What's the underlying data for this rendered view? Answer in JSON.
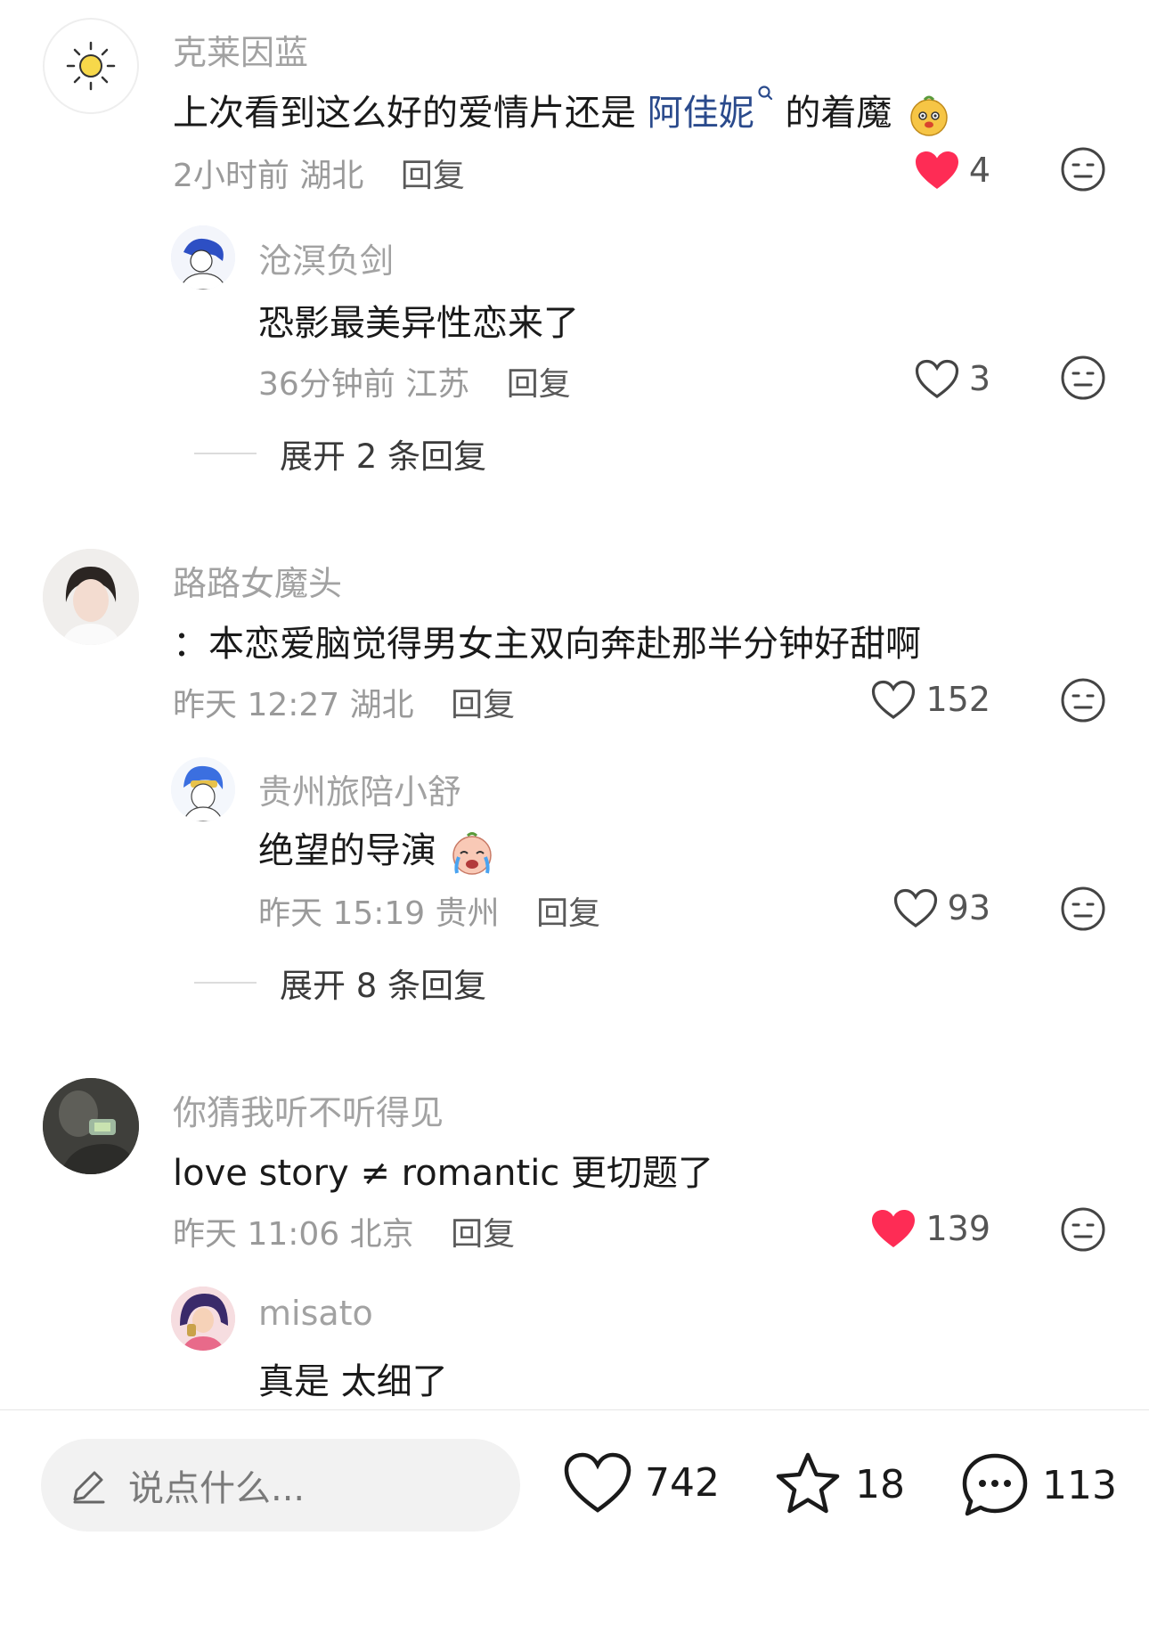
{
  "comments": [
    {
      "username": "克莱因蓝",
      "text_pre": "上次看到这么好的爱情片还是 ",
      "mention": "阿佳妮",
      "text_post": " 的着魔",
      "time": "2小时前",
      "location": "湖北",
      "reply_label": "回复",
      "likes": "4",
      "liked": true,
      "replies": [
        {
          "username": "沧溟负剑",
          "text": "恐影最美异性恋来了",
          "time": "36分钟前",
          "location": "江苏",
          "reply_label": "回复",
          "likes": "3",
          "liked": false
        }
      ],
      "expand_label": "展开 2 条回复"
    },
    {
      "username": "路路女魔头",
      "text": "：本恋爱脑觉得男女主双向奔赴那半分钟好甜啊",
      "time": "昨天 12:27",
      "location": "湖北",
      "reply_label": "回复",
      "likes": "152",
      "liked": false,
      "replies": [
        {
          "username": "贵州旅陪小舒",
          "text": "绝望的导演",
          "time": "昨天 15:19",
          "location": "贵州",
          "reply_label": "回复",
          "likes": "93",
          "liked": false
        }
      ],
      "expand_label": "展开 8 条回复"
    },
    {
      "username": "你猜我听不听得见",
      "text": "love story ≠ romantic 更切题了",
      "time": "昨天 11:06",
      "location": "北京",
      "reply_label": "回复",
      "likes": "139",
      "liked": true,
      "replies": [
        {
          "username": "misato",
          "text": "真是 太细了"
        }
      ]
    }
  ],
  "bottom_bar": {
    "input_placeholder": "说点什么...",
    "like_count": "742",
    "favorite_count": "18",
    "comment_count": "113"
  },
  "colors": {
    "liked_heart": "#fe2c55",
    "mention": "#2a4a8c",
    "username": "#a2a2a2",
    "meta": "#9a9a9a"
  }
}
